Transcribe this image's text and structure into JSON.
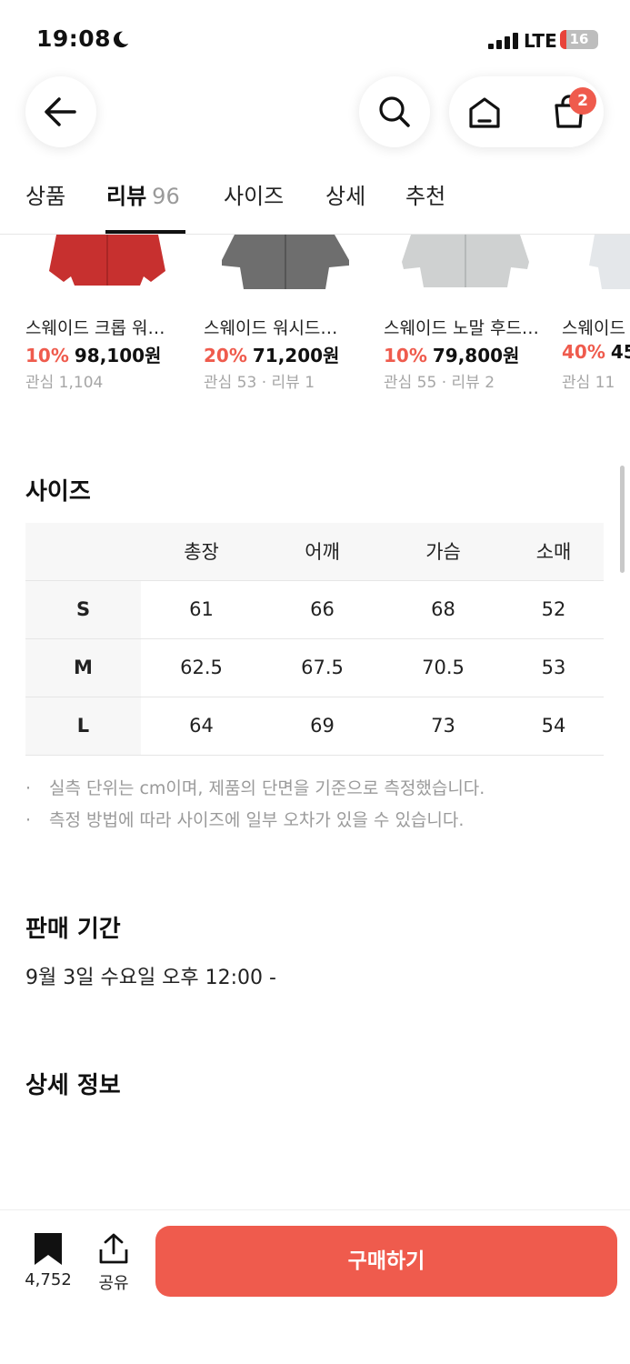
{
  "status_bar": {
    "time": "19:08",
    "network": "LTE",
    "battery": "16",
    "battery_level": 0.16,
    "moon_icon": "moon-icon",
    "signal_icon": "signal-bars-icon"
  },
  "header": {
    "back_icon": "arrow-left-icon",
    "search_icon": "search-icon",
    "home_icon": "home-icon",
    "cart_icon": "shopping-bag-icon",
    "cart_badge": "2"
  },
  "tabs": [
    {
      "label": "상품"
    },
    {
      "label": "리뷰",
      "count": "96",
      "active": true
    },
    {
      "label": "사이즈"
    },
    {
      "label": "상세"
    },
    {
      "label": "추천"
    }
  ],
  "products": [
    {
      "name": "스웨이드 크롭 워…",
      "discount": "10%",
      "price": "98,100원",
      "meta": "관심 1,104",
      "color": "#c7302f"
    },
    {
      "name": "스웨이드 워시드…",
      "discount": "20%",
      "price": "71,200원",
      "meta": "관심 53 · 리뷰 1",
      "color": "#6e6e6e"
    },
    {
      "name": "스웨이드 노말 후드…",
      "discount": "10%",
      "price": "79,800원",
      "meta": "관심 55 · 리뷰 2",
      "color": "#cfd1d1"
    },
    {
      "name": "스웨이드",
      "discount": "40%",
      "price": "45",
      "meta": "관심 11",
      "color": "#e4e7ea"
    }
  ],
  "size_section": {
    "title": "사이즈",
    "headers": [
      "총장",
      "어깨",
      "가슴",
      "소매"
    ],
    "rows": [
      {
        "size": "S",
        "values": [
          "61",
          "66",
          "68",
          "52"
        ]
      },
      {
        "size": "M",
        "values": [
          "62.5",
          "67.5",
          "70.5",
          "53"
        ]
      },
      {
        "size": "L",
        "values": [
          "64",
          "69",
          "73",
          "54"
        ]
      }
    ],
    "notes": [
      "실측 단위는 cm이며, 제품의 단면을 기준으로 측정했습니다.",
      "측정 방법에 따라 사이즈에 일부 오차가 있을 수 있습니다."
    ]
  },
  "sale_section": {
    "title": "판매 기간",
    "period": "9월 3일 수요일 오후 12:00 -"
  },
  "detail_section": {
    "title": "상세 정보"
  },
  "bottom_bar": {
    "bookmark_icon": "bookmark-icon",
    "bookmark_count": "4,752",
    "share_icon": "share-icon",
    "share_label": "공유",
    "buy_label": "구매하기",
    "accent_color": "#ef5b4d"
  }
}
